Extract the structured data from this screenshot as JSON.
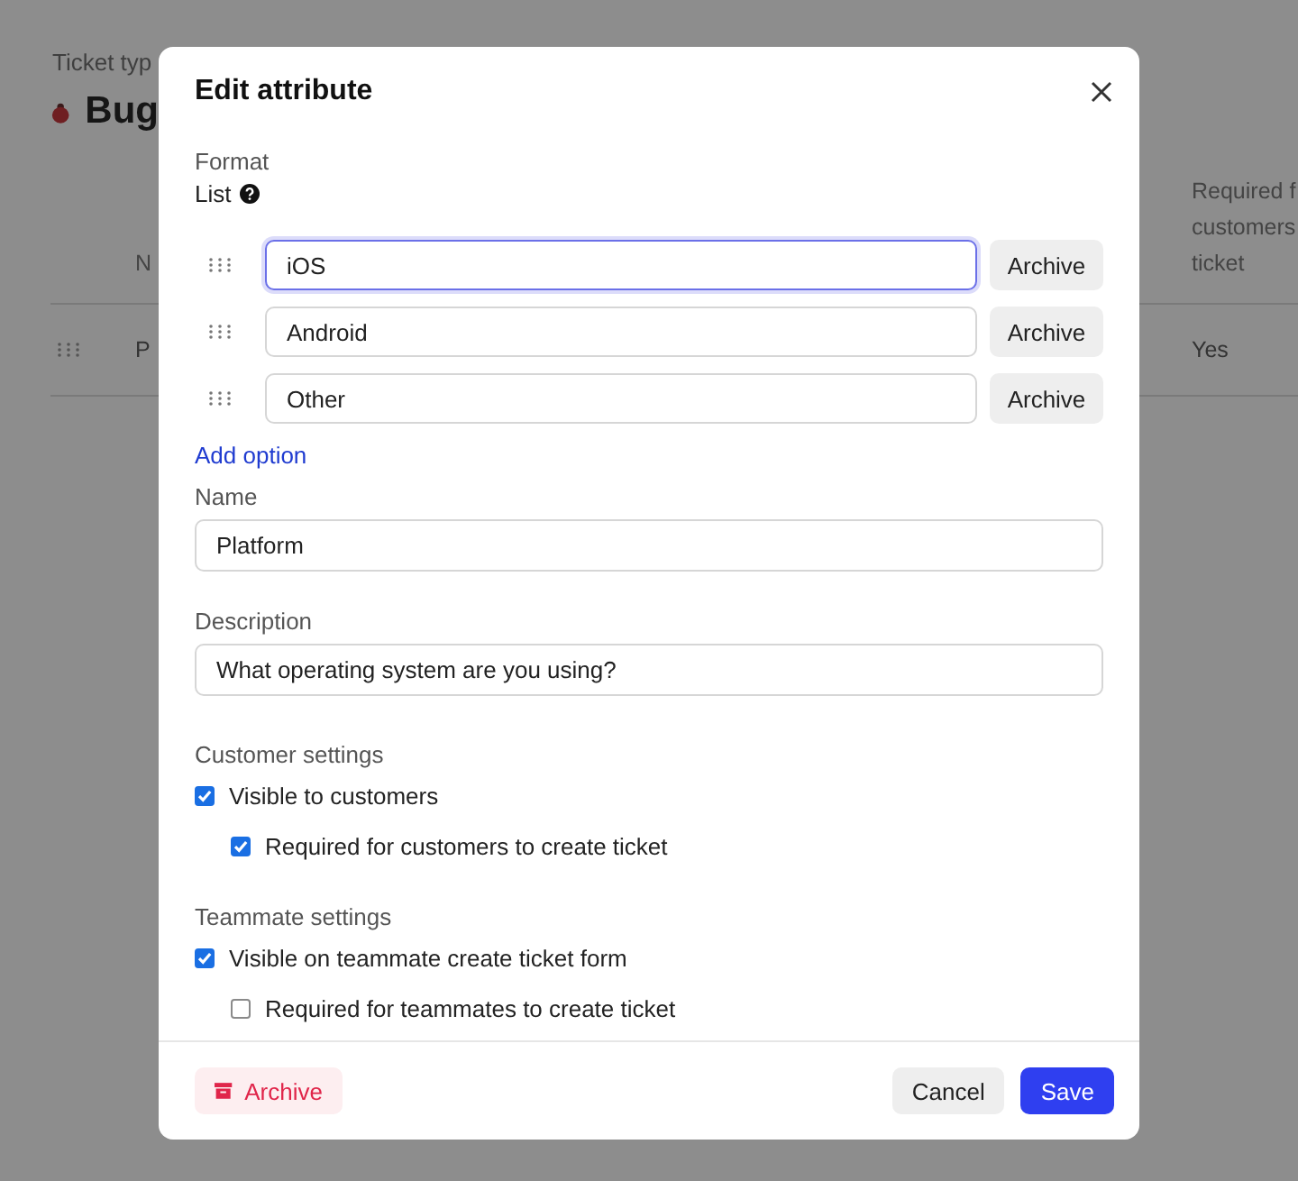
{
  "background": {
    "breadcrumb": "Ticket typ",
    "title": "Bug",
    "table": {
      "columns": [
        {
          "lines": [
            "N"
          ]
        },
        {
          "lines": [
            "Required f",
            "customers",
            "ticket"
          ]
        }
      ],
      "rows": [
        {
          "cells": [
            "P",
            "Yes"
          ]
        }
      ]
    }
  },
  "modal": {
    "title": "Edit attribute",
    "format": {
      "label": "Format",
      "value": "List"
    },
    "options": [
      {
        "value": "iOS",
        "focused": true,
        "action": "Archive"
      },
      {
        "value": "Android",
        "focused": false,
        "action": "Archive"
      },
      {
        "value": "Other",
        "focused": false,
        "action": "Archive"
      }
    ],
    "add_option": "Add option",
    "fields": [
      {
        "label": "Name",
        "value": "Platform"
      },
      {
        "label": "Description",
        "value": "What operating system are you using?"
      }
    ],
    "sections": [
      {
        "title": "Customer settings",
        "options": [
          {
            "label": "Visible to customers",
            "checked": true,
            "children": [
              {
                "label": "Required for customers to create ticket",
                "checked": true
              }
            ]
          }
        ]
      },
      {
        "title": "Teammate settings",
        "options": [
          {
            "label": "Visible on teammate create ticket form",
            "checked": true,
            "children": [
              {
                "label": "Required for teammates to create ticket",
                "checked": false
              }
            ]
          }
        ]
      }
    ],
    "footer": {
      "archive": "Archive",
      "cancel": "Cancel",
      "save": "Save"
    }
  }
}
